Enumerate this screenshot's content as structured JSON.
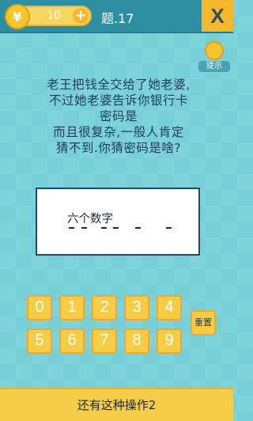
{
  "header": {
    "coin_symbol": "¥",
    "coin_count": "10",
    "plus_symbol": "+",
    "level_title": "题.17",
    "close_symbol": "X"
  },
  "hint": {
    "label": "提示"
  },
  "question": {
    "lines": [
      "老王把钱全交给了她老婆,",
      "不过她老婆告诉你银行卡",
      "密码是",
      "而且很复杂,一般人肯定",
      "猜不到.你猜密码是啥?"
    ]
  },
  "answer": {
    "hint": "六个数字"
  },
  "keypad": {
    "keys": [
      "0",
      "1",
      "2",
      "3",
      "4",
      "5",
      "6",
      "7",
      "8",
      "9"
    ],
    "reset_label": "重置"
  },
  "footer": {
    "title": "还有这种操作2"
  },
  "colors": {
    "background": "#7fd4dc",
    "topbar": "#2d8fa2",
    "accent_yellow": "#f6cc45",
    "text_dark": "#1c3d5c"
  }
}
